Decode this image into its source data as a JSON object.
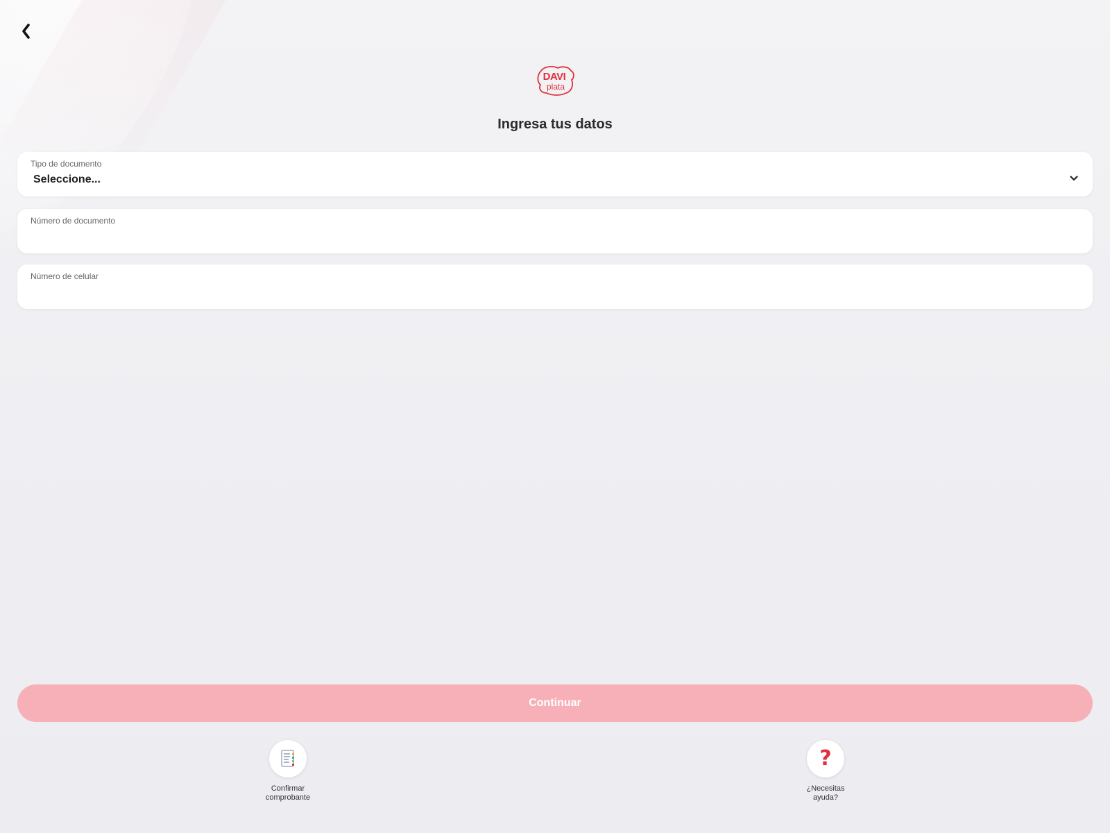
{
  "brand": {
    "logo_line1": "DAVI",
    "logo_line2": "plata",
    "accent_color": "#e0303b",
    "button_color": "#f7b0b8"
  },
  "header": {
    "back_icon": "chevron-left-icon"
  },
  "page": {
    "title": "Ingresa tus datos"
  },
  "form": {
    "document_type": {
      "label": "Tipo de documento",
      "value": "Seleccione...",
      "icon": "chevron-down-icon"
    },
    "document_number": {
      "label": "Número de documento",
      "value": ""
    },
    "phone_number": {
      "label": "Número de celular",
      "value": ""
    }
  },
  "actions": {
    "continue_label": "Continuar"
  },
  "quick_actions": [
    {
      "label": "Confirmar\ncomprobante",
      "icon": "receipt-icon"
    },
    {
      "label": "¿Necesitas\nayuda?",
      "icon": "question-mark-icon",
      "glyph": "?"
    }
  ]
}
